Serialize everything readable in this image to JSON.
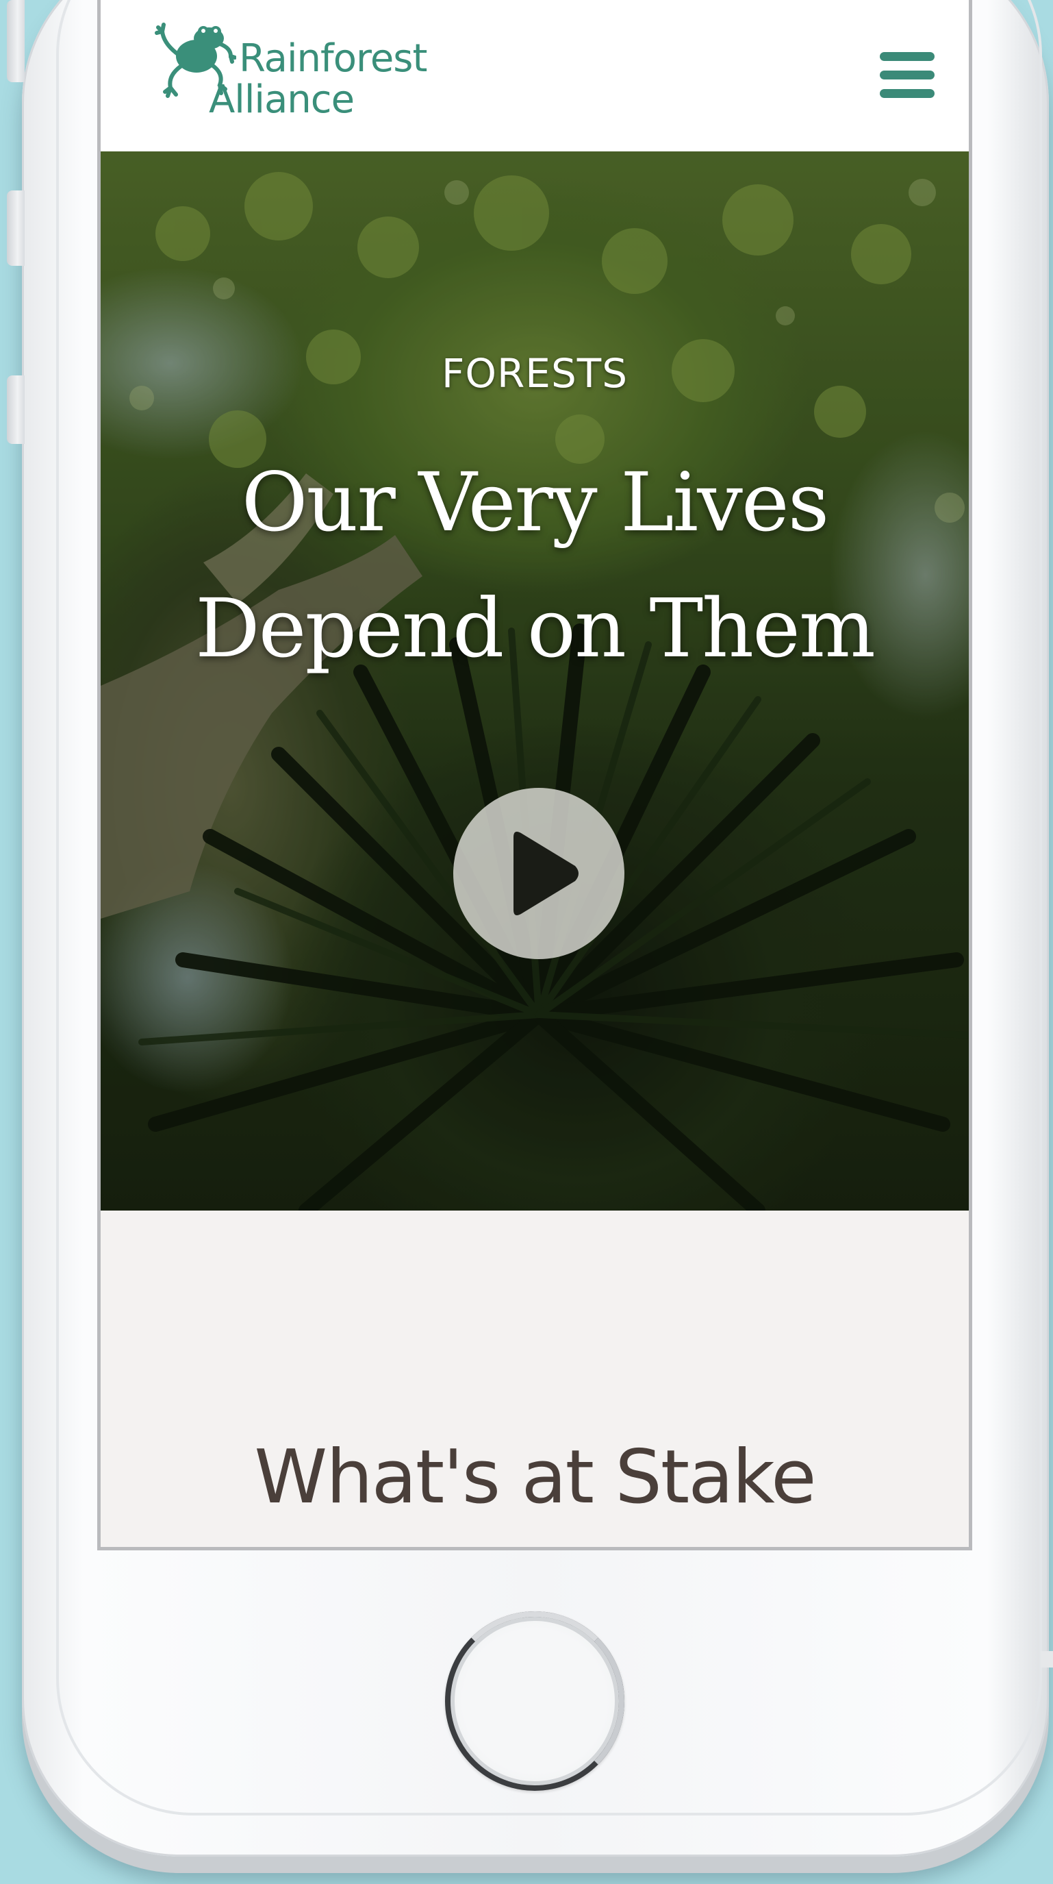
{
  "brand": {
    "line1": "Rainforest",
    "line2": "Alliance",
    "color": "#3a8f7a"
  },
  "header": {
    "menu_icon": "hamburger-menu-icon"
  },
  "hero": {
    "kicker": "FORESTS",
    "title_line1": "Our Very Lives",
    "title_line2": "Depend on Them",
    "play_icon": "play-icon"
  },
  "section": {
    "title": "What's at Stake"
  },
  "colors": {
    "accent": "#3b8a78",
    "heading": "#4a3f3a",
    "background": "#f4f2f1",
    "page_background": "#a9dbe2"
  }
}
